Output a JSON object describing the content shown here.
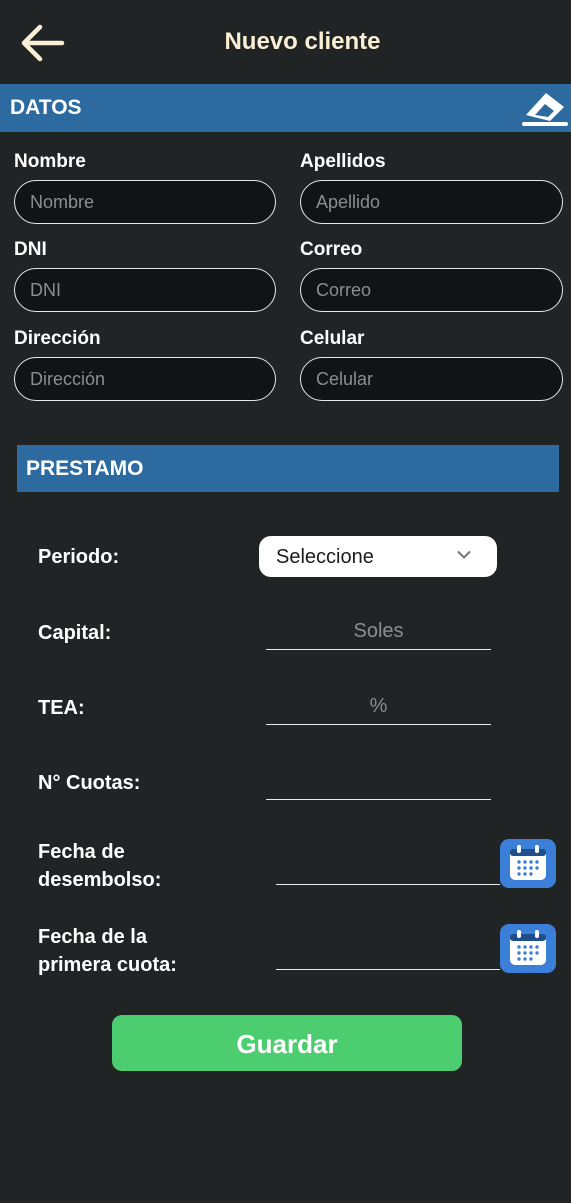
{
  "header": {
    "title": "Nuevo cliente",
    "back_icon": "arrow-left-icon"
  },
  "datos": {
    "title": "DATOS",
    "clear_icon": "eraser-icon",
    "fields": {
      "nombre": {
        "label": "Nombre",
        "placeholder": "Nombre",
        "value": ""
      },
      "apellidos": {
        "label": "Apellidos",
        "placeholder": "Apellido",
        "value": ""
      },
      "dni": {
        "label": "DNI",
        "placeholder": "DNI",
        "value": ""
      },
      "correo": {
        "label": "Correo",
        "placeholder": "Correo",
        "value": ""
      },
      "direccion": {
        "label": "Dirección",
        "placeholder": "Dirección",
        "value": ""
      },
      "celular": {
        "label": "Celular",
        "placeholder": "Celular",
        "value": ""
      }
    }
  },
  "prestamo": {
    "title": "PRESTAMO",
    "periodo": {
      "label": "Periodo:",
      "selected": "Seleccione"
    },
    "capital": {
      "label": "Capital:",
      "placeholder": "Soles"
    },
    "tea": {
      "label": "TEA:",
      "placeholder": "%"
    },
    "cuotas": {
      "label": "N° Cuotas:",
      "placeholder": ""
    },
    "fecha_desembolso": {
      "label_line1": "Fecha de",
      "label_line2": "desembolso:",
      "icon": "calendar-icon"
    },
    "fecha_primera_cuota": {
      "label_line1": "Fecha de la",
      "label_line2": "primera cuota:",
      "icon": "calendar-icon"
    }
  },
  "actions": {
    "save_label": "Guardar"
  },
  "colors": {
    "background": "#202424",
    "section": "#2c6aa0",
    "title": "#fbf0d6",
    "save": "#4ccd70",
    "calendar": "#3b7fd9"
  }
}
